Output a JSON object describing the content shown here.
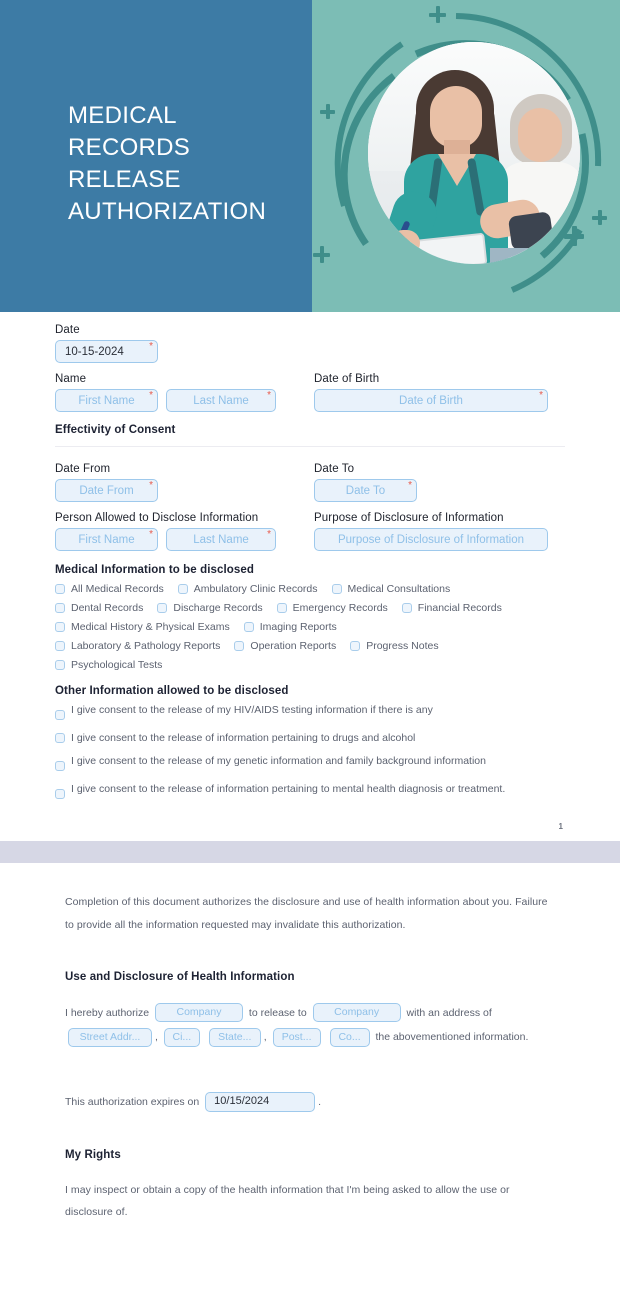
{
  "hero": {
    "title": "MEDICAL\nRECORDS\nRELEASE\nAUTHORIZATION"
  },
  "colors": {
    "panel_blue": "#3d7ba5",
    "panel_teal": "#7cbdb5",
    "ring_teal": "#3f8e8a",
    "field_fill": "#e9f2fb",
    "field_border": "#9ec9ec",
    "placeholder": "#8fc0e8",
    "required_red": "#e8594a",
    "page_gap": "#d6d7e5"
  },
  "form": {
    "date": {
      "label": "Date",
      "value": "10-15-2024",
      "required": "*"
    },
    "name": {
      "label": "Name",
      "first_placeholder": "First Name",
      "last_placeholder": "Last Name",
      "required": "*"
    },
    "dob": {
      "label": "Date of Birth",
      "placeholder": "Date of Birth",
      "required": "*"
    },
    "effectivity_title": "Effectivity of Consent",
    "date_from": {
      "label": "Date From",
      "placeholder": "Date From",
      "required": "*"
    },
    "date_to": {
      "label": "Date To",
      "placeholder": "Date To",
      "required": "*"
    },
    "discloser": {
      "label": "Person Allowed to Disclose Information",
      "first_placeholder": "First Name",
      "last_placeholder": "Last Name",
      "required": "*"
    },
    "purpose": {
      "label": "Purpose of Disclosure of Information",
      "placeholder": "Purpose of Disclosure of Information"
    }
  },
  "medical_info": {
    "title": "Medical Information to be disclosed",
    "rows": [
      [
        "All Medical Records",
        "Ambulatory Clinic Records",
        "Medical Consultations"
      ],
      [
        "Dental Records",
        "Discharge Records",
        "Emergency Records",
        "Financial Records"
      ],
      [
        "Medical History & Physical Exams",
        "Imaging Reports"
      ],
      [
        "Laboratory & Pathology Reports",
        "Operation Reports",
        "Progress Notes"
      ],
      [
        "Psychological Tests"
      ]
    ]
  },
  "other_info": {
    "title": "Other Information allowed to be disclosed",
    "items": [
      "I give consent to the release of my HIV/AIDS testing information if there is any",
      "I give consent to the release of information pertaining to drugs and alcohol",
      "I give consent to the release of my genetic information and family background information",
      "I give consent to the release of information pertaining to mental health diagnosis or treatment."
    ]
  },
  "page_number": "1",
  "page2": {
    "intro": "Completion of this document authorizes the disclosure and use of health information about you. Failure to provide all the information requested may invalidate this authorization.",
    "use_title": "Use and Disclosure of Health Information",
    "auth_t1": "I hereby authorize",
    "auth_company1": "Company",
    "auth_t2": "to release to",
    "auth_company2": "Company",
    "auth_t3": "with an address",
    "auth_t4": "of",
    "addr_street": "Street Addr...",
    "addr_comma1": ",",
    "addr_city": "Ci...",
    "addr_state": "State...",
    "addr_comma2": ",",
    "addr_post": "Post...",
    "addr_country": "Co...",
    "auth_t5": "the abovementioned",
    "auth_t6": "information.",
    "expiry_prefix": "This authorization expires on",
    "expiry_value": "10/15/2024",
    "expiry_suffix": ".",
    "rights_title": "My Rights",
    "rights_body": "I may inspect or obtain a copy of the health information that I'm being asked to allow the use or disclosure of."
  }
}
